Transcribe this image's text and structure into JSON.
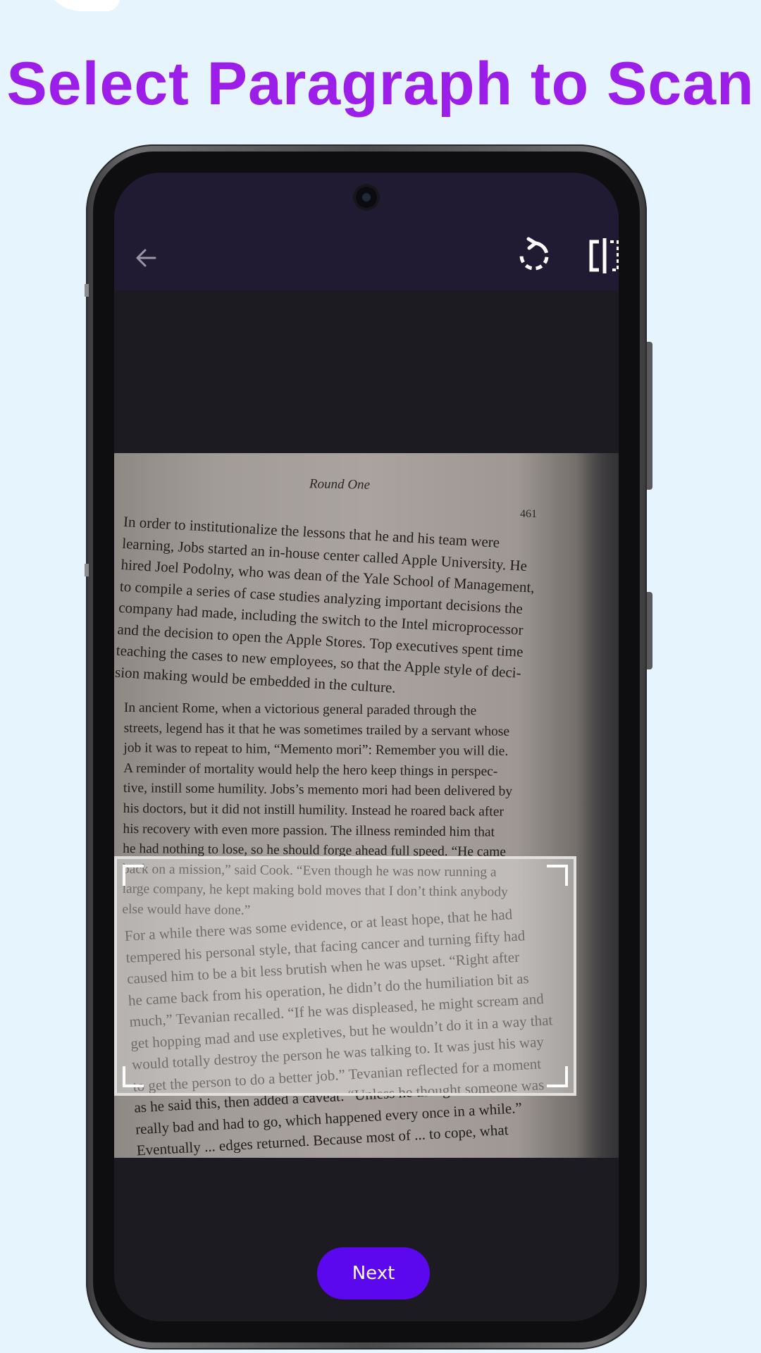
{
  "headline": "Select Paragraph to Scan",
  "colors": {
    "headline": "#9b1fe8",
    "accent": "#5b08ef",
    "toolbar": "#211a33",
    "background": "#e6f4fe"
  },
  "toolbar": {
    "back_icon": "arrow-left-icon",
    "rotate_icon": "rotate-clockwise-icon",
    "compare_icon": "split-compare-icon"
  },
  "document": {
    "header": "Round One",
    "page_number": "461",
    "para_top": [
      "In order to institutionalize the lessons that he and his team were",
      "learning, Jobs started an in-house center called Apple University. He",
      "hired Joel Podolny, who was dean of the Yale School of Management,",
      "to compile a series of case studies analyzing important decisions the",
      "company had made, including the switch to the Intel microprocessor",
      "and the decision to open the Apple Stores. Top executives spent time",
      "teaching the cases to new employees, so that the Apple style of deci-",
      "sion making would be embedded in the culture."
    ],
    "para_selected": [
      "In ancient Rome, when a victorious general paraded through the",
      "streets, legend has it that he was sometimes trailed by a servant whose",
      "job it was to repeat to him, “Memento mori”: Remember you will die.",
      "A reminder of mortality would help the hero keep things in perspec-",
      "tive, instill some humility. Jobs’s memento mori had been delivered by",
      "his doctors, but it did not instill humility. Instead he roared back after",
      "his recovery with even more passion. The illness reminded him that",
      "he had nothing to lose, so he should forge ahead full speed. “He came",
      "back on a mission,” said Cook. “Even though he was now running a",
      "large company, he kept making bold moves that I don’t think anybody",
      "else would have done.”"
    ],
    "para_bottom": [
      "For a while there was some evidence, or at least hope, that he had",
      "tempered his personal style, that facing cancer and turning fifty had",
      "caused him to be a bit less brutish when he was upset. “Right after",
      "he came back from his operation, he didn’t do the humiliation bit as",
      "much,” Tevanian recalled. “If he was displeased, he might scream and",
      "get hopping mad and use expletives, but he wouldn’t do it in a way that",
      "would totally destroy the person he was talking to. It was just his way",
      "to get the person to do a better job.” Tevanian reflected for a moment",
      "as he said this, then added a caveat: “Unless he thought someone was",
      "really bad and had to go, which happened every once in a while.”",
      "Eventually ... edges returned. Because most of ... to cope, what"
    ]
  },
  "next_button": "Next"
}
